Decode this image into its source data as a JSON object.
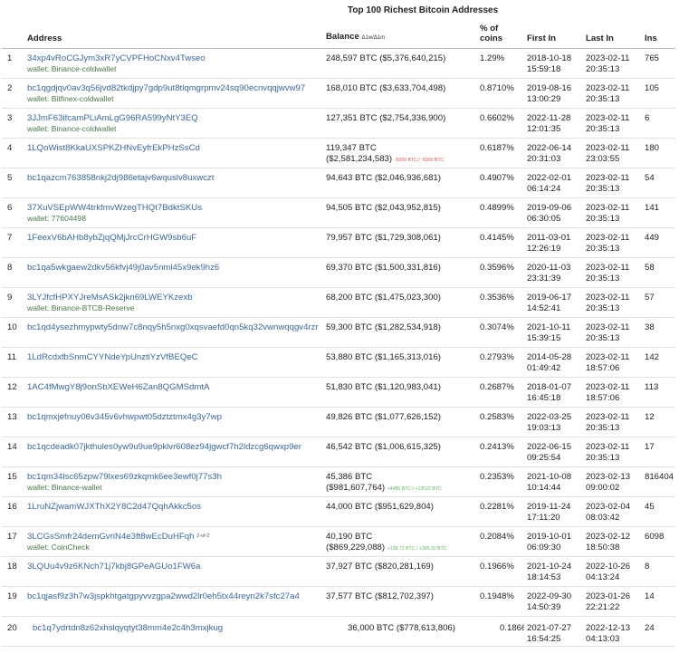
{
  "page": {
    "title": "Top 100 Richest Bitcoin Addresses"
  },
  "colors": {
    "link": "#3a67a3",
    "wallet": "#4a7a4a",
    "negative": "#d9534f",
    "positive": "#5cb85c"
  },
  "table": {
    "headers": {
      "address": "Address",
      "balance": "Balance",
      "balance_sub": "Δ1w/Δ1m",
      "pct": "% of coins",
      "first_in": "First In",
      "last_in": "Last In",
      "ins": "Ins"
    },
    "rows": [
      {
        "n": "1",
        "address": "34xp4vRoCGJym3xR7yCVPFHoCNxv4Twseo",
        "wallet": "wallet: Binance-coldwallet",
        "btc": "248,597 BTC",
        "usd": "($5,376,640,215)",
        "pct": "1.29%",
        "first_date": "2018-10-18",
        "first_time": "15:59:18",
        "last_date": "2023-02-11",
        "last_time": "20:35:13",
        "ins": "765"
      },
      {
        "n": "2",
        "address": "bc1qgdjqv0av3q56jvd82tkdjpy7gdp9ut8tlqmgrpmv24sq90ecnvqqjwvw97",
        "wallet": "wallet: Bitfinex-coldwallet",
        "btc": "168,010 BTC",
        "usd": "($3,633,704,498)",
        "pct": "0.8710%",
        "first_date": "2019-08-16",
        "first_time": "13:00:29",
        "last_date": "2023-02-11",
        "last_time": "20:35:13",
        "ins": "105"
      },
      {
        "n": "3",
        "address": "3JJmF63ifcamPLiAmLgG96RA599yNtY3EQ",
        "wallet": "wallet: Binance-coldwallet",
        "btc": "127,351 BTC",
        "usd": "($2,754,336,900)",
        "pct": "0.6602%",
        "first_date": "2022-11-28",
        "first_time": "12:01:35",
        "last_date": "2023-02-11",
        "last_time": "20:35:13",
        "ins": "6"
      },
      {
        "n": "4",
        "address": "1LQoWist8KkaUXSPKZHNvEyfrEkPHzSsCd",
        "wallet": "",
        "btc": "119,347 BTC",
        "usd": "($2,581,234,583)",
        "d1": "-5000 BTC",
        "d2": " / -5000 BTC",
        "dcls": "neg",
        "pct": "0.6187%",
        "first_date": "2022-06-14",
        "first_time": "20:31:03",
        "last_date": "2023-02-11",
        "last_time": "23:03:55",
        "ins": "180"
      },
      {
        "n": "5",
        "address": "bc1qazcm763858nkj2dj986etajv6wquslv8uxwczt",
        "wallet": "",
        "btc": "94,643 BTC",
        "usd": "($2,046,936,681)",
        "pct": "0.4907%",
        "first_date": "2022-02-01",
        "first_time": "06:14:24",
        "last_date": "2023-02-11",
        "last_time": "20:35:13",
        "ins": "54"
      },
      {
        "n": "6",
        "address": "37XuVSEpWW4trkfmvWzegTHQt7BdktSKUs",
        "wallet": "wallet: 77604498",
        "btc": "94,505 BTC",
        "usd": "($2,043,952,815)",
        "pct": "0.4899%",
        "first_date": "2019-09-06",
        "first_time": "06:30:05",
        "last_date": "2023-02-11",
        "last_time": "20:35:13",
        "ins": "141"
      },
      {
        "n": "7",
        "address": "1FeexV6bAHb8ybZjqQMjJrcCrHGW9sb6uF",
        "wallet": "",
        "btc": "79,957 BTC",
        "usd": "($1,729,308,061)",
        "pct": "0.4145%",
        "first_date": "2011-03-01",
        "first_time": "12:26:19",
        "last_date": "2023-02-11",
        "last_time": "20:35:13",
        "ins": "449"
      },
      {
        "n": "8",
        "address": "bc1qa5wkgaew2dkv56kfvj49j0av5nml45x9ek9hz6",
        "wallet": "",
        "btc": "69,370 BTC",
        "usd": "($1,500,331,816)",
        "pct": "0.3596%",
        "first_date": "2020-11-03",
        "first_time": "23:31:39",
        "last_date": "2023-02-11",
        "last_time": "20:35:13",
        "ins": "58"
      },
      {
        "n": "9",
        "address": "3LYJfcfHPXYJreMsASk2jkn69LWEYKzexb",
        "wallet": "wallet: Binance-BTCB-Reserve",
        "btc": "68,200 BTC",
        "usd": "($1,475,023,300)",
        "pct": "0.3536%",
        "first_date": "2019-06-17",
        "first_time": "14:52:41",
        "last_date": "2023-02-11",
        "last_time": "20:35:13",
        "ins": "57"
      },
      {
        "n": "10",
        "address": "bc1qd4ysezhmypwty5dnw7c8nqy5h5nxg0xqsvaefd0qn5kq32vwnwqqgv4rzr",
        "wallet": "",
        "btc": "59,300 BTC",
        "usd": "($1,282,534,918)",
        "pct": "0.3074%",
        "first_date": "2021-10-11",
        "first_time": "15:39:15",
        "last_date": "2023-02-11",
        "last_time": "20:35:13",
        "ins": "38"
      },
      {
        "n": "11",
        "address": "1LdRcdxfbSnmCYYNdeYpUnztiYzVfBEQeC",
        "wallet": "",
        "btc": "53,880 BTC",
        "usd": "($1,165,313,016)",
        "pct": "0.2793%",
        "first_date": "2014-05-28",
        "first_time": "01:49:42",
        "last_date": "2023-02-11",
        "last_time": "18:57:06",
        "ins": "142"
      },
      {
        "n": "12",
        "address": "1AC4fMwgY8j9onSbXEWeH6Zan8QGMSdmtA",
        "wallet": "",
        "btc": "51,830 BTC",
        "usd": "($1,120,983,041)",
        "pct": "0.2687%",
        "first_date": "2018-01-07",
        "first_time": "16:45:18",
        "last_date": "2023-02-11",
        "last_time": "18:57:06",
        "ins": "113"
      },
      {
        "n": "13",
        "address": "bc1qmxjefnuy06v345v6vhwpwt05dztztmx4g3y7wp",
        "wallet": "",
        "btc": "49,826 BTC",
        "usd": "($1,077,626,152)",
        "pct": "0.2583%",
        "first_date": "2022-03-25",
        "first_time": "19:03:13",
        "last_date": "2023-02-11",
        "last_time": "20:35:13",
        "ins": "12"
      },
      {
        "n": "14",
        "address": "bc1qcdeadk07jkthules0yw9u9ue9pklvr608ez94jgwcf7h2ldzcg6qwxp9er",
        "wallet": "",
        "btc": "46,542 BTC",
        "usd": "($1,006,615,325)",
        "pct": "0.2413%",
        "first_date": "2022-06-15",
        "first_time": "09:25:54",
        "last_date": "2023-02-11",
        "last_time": "20:35:13",
        "ins": "17"
      },
      {
        "n": "15",
        "address": "bc1qm34lsc65zpw79lxes69zkqmk6ee3ewf0j77s3h",
        "wallet": "wallet: Binance-wallet",
        "btc": "45,386 BTC",
        "usd": "($981,607,764)",
        "d1": "+4485 BTC",
        "d2": " / +13522 BTC",
        "dcls": "pos",
        "pct": "0.2353%",
        "first_date": "2021-10-08",
        "first_time": "10:14:44",
        "last_date": "2023-02-13",
        "last_time": "09:00:02",
        "ins": "816404"
      },
      {
        "n": "16",
        "address": "1LruNZjwamWJXThX2Y8C2d47QqhAkkc5os",
        "wallet": "",
        "btc": "44,000 BTC",
        "usd": "($951,629,804)",
        "pct": "0.2281%",
        "first_date": "2019-11-24",
        "first_time": "17:11:20",
        "last_date": "2023-02-04",
        "last_time": "08:03:42",
        "ins": "45"
      },
      {
        "n": "17",
        "address": "3LCGsSmfr24demGvriN4e3ft8wEcDuHFqh",
        "sup": "2-of-2",
        "wallet": "wallet: CoinCheck",
        "btc": "40,190 BTC",
        "usd": "($869,229,088)",
        "d1": "+138.72 BTC",
        "d2": " / +365.32 BTC",
        "dcls": "pos",
        "pct": "0.2084%",
        "first_date": "2019-10-01",
        "first_time": "06:09:30",
        "last_date": "2023-02-12",
        "last_time": "18:50:38",
        "ins": "6098"
      },
      {
        "n": "18",
        "address": "3LQUu4v9z6KNch71j7kbj8GPeAGUo1FW6a",
        "wallet": "",
        "btc": "37,927 BTC",
        "usd": "($820,281,169)",
        "pct": "0.1966%",
        "first_date": "2021-10-24",
        "first_time": "18:14:53",
        "last_date": "2022-10-26",
        "last_time": "04:13:24",
        "ins": "8"
      },
      {
        "n": "19",
        "address": "bc1qjasf9z3h7w3jspkhtgatgpyvvzgpa2wwd2lr0eh5tx44reyn2k7sfc27a4",
        "wallet": "",
        "btc": "37,577 BTC",
        "usd": "($812,702,397)",
        "pct": "0.1948%",
        "first_date": "2022-09-30",
        "first_time": "14:50:39",
        "last_date": "2023-01-26",
        "last_time": "22:21:22",
        "ins": "14"
      },
      {
        "n": "20",
        "address": "bc1q7ydrtdn8z62xhslqyqtyt38mm4e2c4h3mxjkug",
        "wallet": "",
        "btc": "36,000 BTC",
        "usd": "($778,613,806)",
        "pct": "0.1866%",
        "first_date": "2021-07-27",
        "first_time": "16:54:25",
        "last_date": "2022-12-13",
        "last_time": "04:13:03",
        "ins": "24",
        "last": true
      }
    ]
  }
}
